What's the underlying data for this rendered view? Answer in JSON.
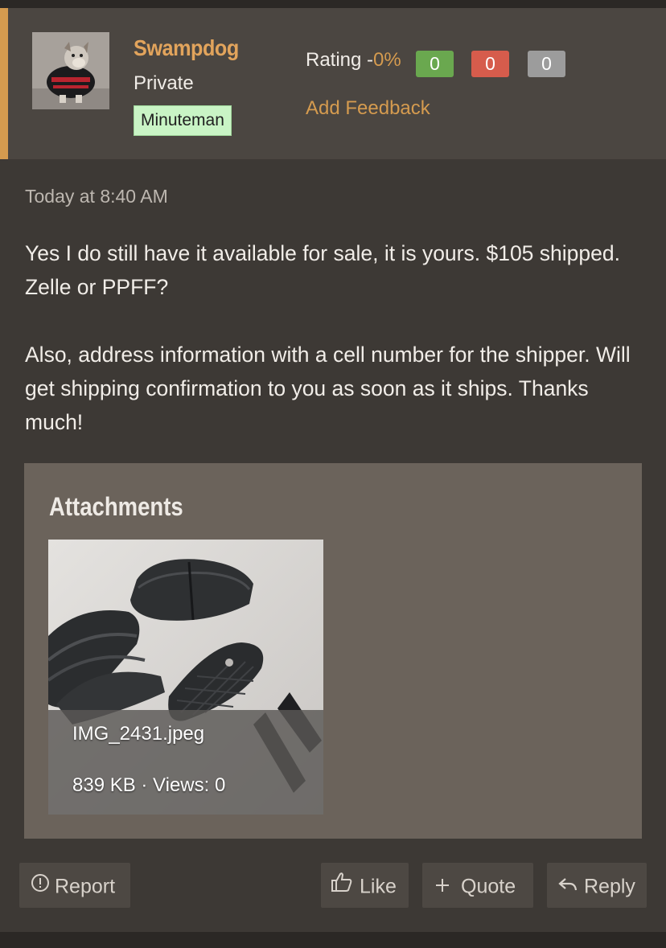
{
  "post": {
    "author": {
      "name": "Swampdog",
      "title": "Private",
      "badge": "Minuteman"
    },
    "rating": {
      "label": "Rating -",
      "percent": "0%",
      "positive": "0",
      "negative": "0",
      "neutral": "0",
      "add_feedback": "Add Feedback"
    },
    "timestamp": "Today at 8:40 AM",
    "body": {
      "paragraph1": "Yes I do still have it available for sale, it is yours. $105 shipped. Zelle or PPFF?",
      "paragraph2": "Also, address information with a cell number for the shipper. Will get shipping confirmation to you as soon as it ships. Thanks much!"
    },
    "attachments": {
      "title": "Attachments",
      "items": [
        {
          "file_name": "IMG_2431.jpeg",
          "info": "839 KB · Views: 0"
        }
      ]
    },
    "actions": {
      "report": "Report",
      "like": "Like",
      "quote": "Quote",
      "reply": "Reply"
    }
  },
  "colors": {
    "accent": "#d59b4f",
    "username": "#e2a45c",
    "rating_positive": "#6aa84f",
    "rating_negative": "#d65c4c",
    "rating_neutral": "#9c9c9c",
    "badge_bg": "#c9f4c5"
  },
  "icons": {
    "report": "exclamation-circle-icon",
    "like": "thumbs-up-icon",
    "quote": "plus-icon",
    "reply": "reply-arrow-icon"
  }
}
